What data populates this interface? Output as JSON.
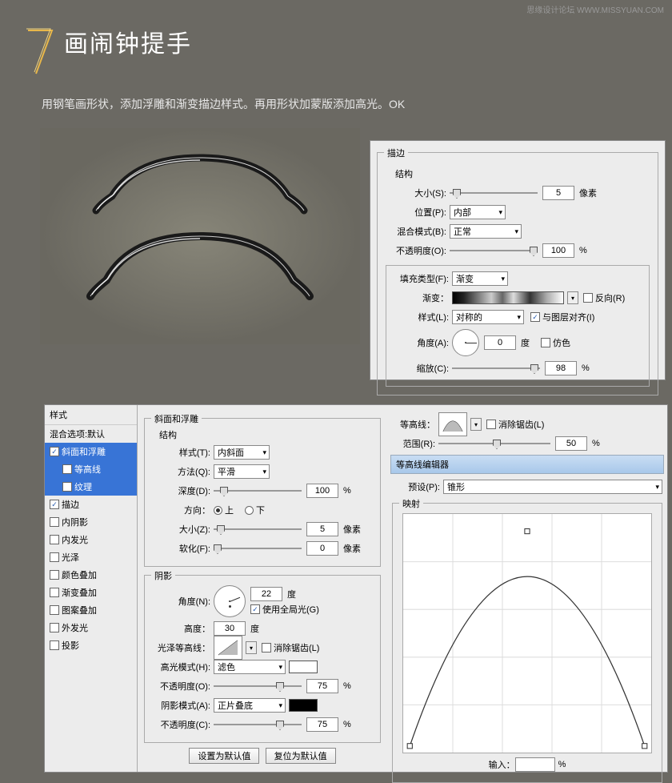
{
  "watermark": "思缘设计论坛 WWW.MISSYUAN.COM",
  "step": {
    "num": "7",
    "title": "画闹钟提手",
    "desc": "用钢笔画形状，添加浮雕和渐变描边样式。再用形状加蒙版添加高光。OK"
  },
  "stroke": {
    "group": "描边",
    "sub": "结构",
    "size_lbl": "大小(S):",
    "size": "5",
    "size_unit": "像素",
    "pos_lbl": "位置(P):",
    "pos": "内部",
    "blend_lbl": "混合模式(B):",
    "blend": "正常",
    "op_lbl": "不透明度(O):",
    "op": "100",
    "op_unit": "%",
    "fill_lbl": "填充类型(F):",
    "fill": "渐变",
    "grad_lbl": "渐变：",
    "reverse": "反向(R)",
    "style_lbl": "样式(L):",
    "style": "对称的",
    "align": "与图层对齐(I)",
    "angle_lbl": "角度(A):",
    "angle": "0",
    "angle_unit": "度",
    "dither": "仿色",
    "scale_lbl": "缩放(C):",
    "scale": "98",
    "scale_unit": "%"
  },
  "list": {
    "hdr": "样式",
    "blend": "混合选项:默认",
    "bevel": "斜面和浮雕",
    "contour": "等高线",
    "texture": "纹理",
    "stroke": "描边",
    "inner_shadow": "内阴影",
    "inner_glow": "内发光",
    "satin": "光泽",
    "color_ov": "颜色叠加",
    "grad_ov": "渐变叠加",
    "pat_ov": "图案叠加",
    "outer_glow": "外发光",
    "drop": "投影"
  },
  "bevel": {
    "group": "斜面和浮雕",
    "sub": "结构",
    "style_lbl": "样式(T):",
    "style": "内斜面",
    "tech_lbl": "方法(Q):",
    "tech": "平滑",
    "depth_lbl": "深度(D):",
    "depth": "100",
    "depth_unit": "%",
    "dir_lbl": "方向：",
    "up": "上",
    "down": "下",
    "size_lbl": "大小(Z):",
    "size": "5",
    "size_unit": "像素",
    "soft_lbl": "软化(F):",
    "soft": "0",
    "soft_unit": "像素",
    "shade": "阴影",
    "angle_lbl": "角度(N):",
    "angle": "22",
    "angle_unit": "度",
    "global": "使用全局光(G)",
    "alt_lbl": "高度：",
    "alt": "30",
    "alt_unit": "度",
    "gloss_lbl": "光泽等高线：",
    "aa": "消除锯齿(L)",
    "hi_lbl": "高光模式(H):",
    "hi_mode": "滤色",
    "hi_op_lbl": "不透明度(O):",
    "hi_op": "75",
    "hi_op_unit": "%",
    "sh_lbl": "阴影模式(A):",
    "sh_mode": "正片叠底",
    "sh_op_lbl": "不透明度(C):",
    "sh_op": "75",
    "sh_op_unit": "%",
    "btn1": "设置为默认值",
    "btn2": "复位为默认值"
  },
  "right": {
    "contour_lbl": "等高线：",
    "aa": "消除锯齿(L)",
    "range_lbl": "范围(R):",
    "range": "50",
    "range_unit": "%",
    "editor": "等高线编辑器",
    "preset_lbl": "预设(P):",
    "preset": "锥形",
    "map": "映射",
    "input": "输入：",
    "input_unit": "%"
  }
}
